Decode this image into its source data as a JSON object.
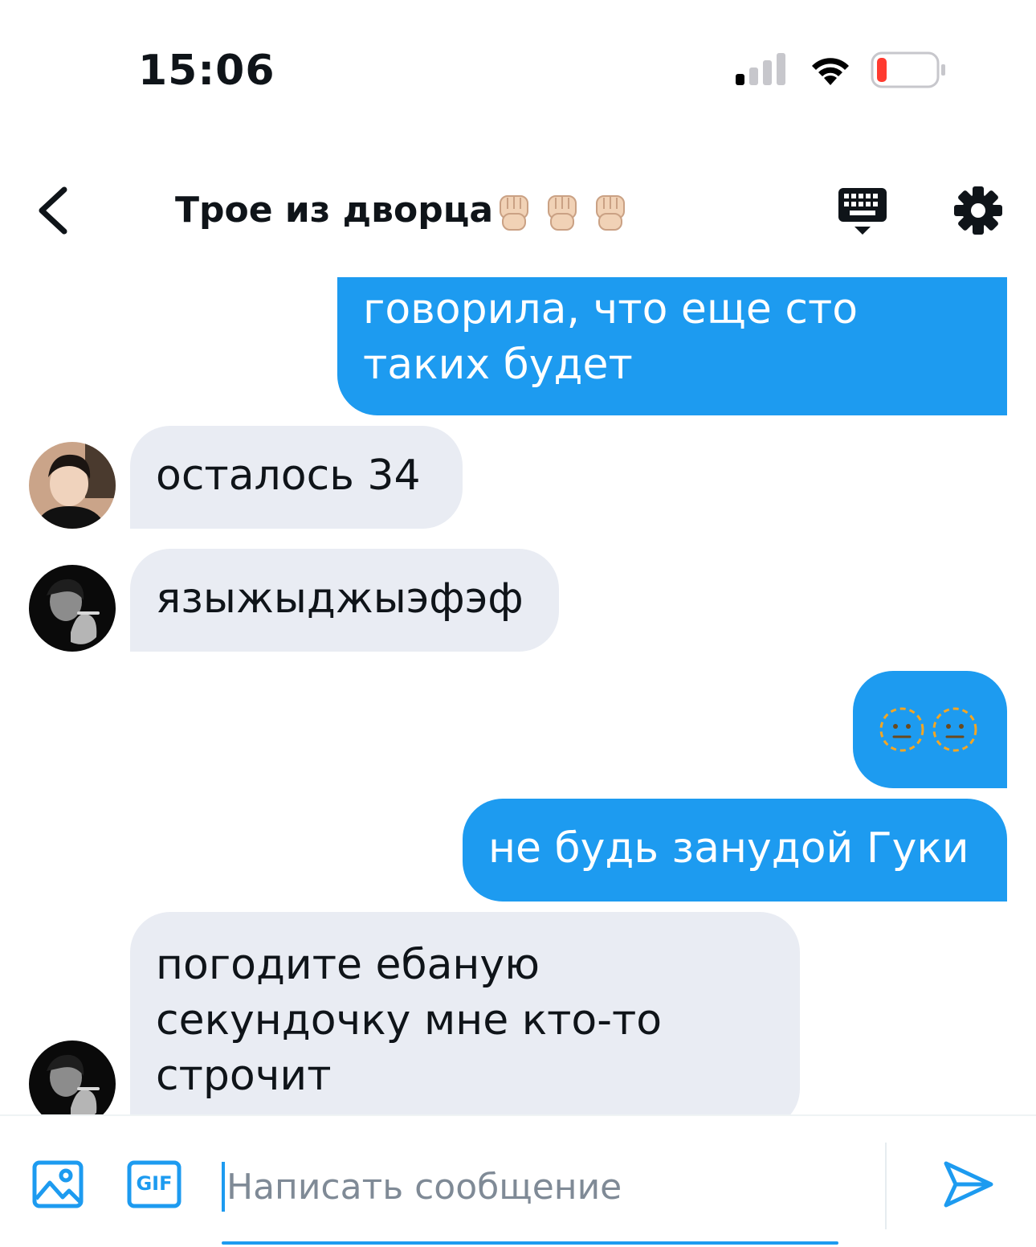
{
  "status_bar": {
    "time": "15:06",
    "icons": [
      "signal-icon",
      "wifi-icon",
      "battery-low-icon"
    ]
  },
  "header": {
    "back_icon": "chevron-left-icon",
    "title": "Трое из дворца",
    "title_emoji": [
      "raised-fist-icon",
      "raised-fist-icon",
      "raised-fist-icon"
    ],
    "keyboard_icon": "keyboard-icon",
    "settings_icon": "gear-icon"
  },
  "messages": [
    {
      "direction": "outgoing",
      "lines": [
        "говорила, что еще сто",
        "таких будет"
      ]
    },
    {
      "direction": "incoming",
      "text": "осталось 34",
      "avatar": "avatar-1"
    },
    {
      "direction": "incoming",
      "text": "языжыджыэфэф",
      "avatar": "avatar-2"
    },
    {
      "direction": "outgoing",
      "emoji": [
        "neutral-face-icon",
        "neutral-face-icon"
      ]
    },
    {
      "direction": "outgoing",
      "text": "не будь занудой Гуки"
    },
    {
      "direction": "incoming",
      "lines": [
        "погодите ебаную",
        "секундочку мне кто-то",
        "строчит"
      ],
      "avatar": "avatar-2"
    }
  ],
  "composer": {
    "placeholder": "Написать сообщение",
    "media_icon": "image-icon",
    "gif_label": "GIF",
    "send_icon": "send-icon"
  },
  "colors": {
    "accent": "#1d9bf0",
    "incoming_bubble": "#e9ecf3",
    "text": "#0f1419",
    "battery_low": "#ff3b30"
  }
}
